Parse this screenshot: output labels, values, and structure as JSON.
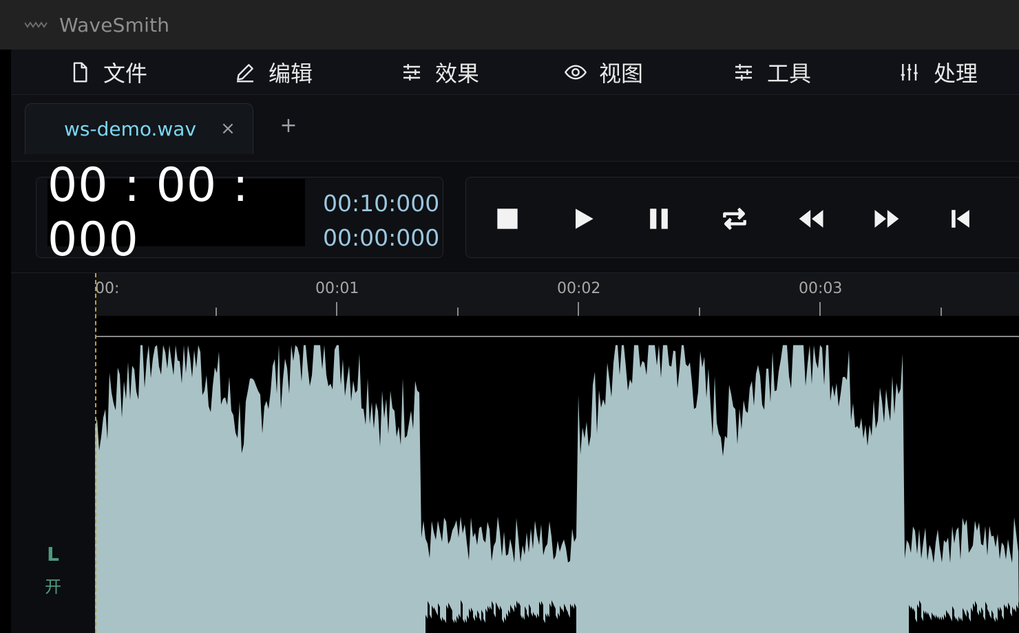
{
  "app": {
    "title": "WaveSmith",
    "logo_icon": "wave-logo-icon"
  },
  "menu": [
    {
      "label": "文件",
      "icon": "file-icon"
    },
    {
      "label": "编辑",
      "icon": "pencil-icon"
    },
    {
      "label": "效果",
      "icon": "sliders-icon"
    },
    {
      "label": "视图",
      "icon": "eye-icon"
    },
    {
      "label": "工具",
      "icon": "sliders-icon"
    },
    {
      "label": "处理",
      "icon": "levels-icon"
    }
  ],
  "tabs": [
    {
      "label": "ws-demo.wav",
      "close": "×",
      "active": true
    }
  ],
  "add_tab": "+",
  "time": {
    "current": "00 : 00 : 000",
    "total": "00:10:000",
    "selection": "00:00:000"
  },
  "transport": [
    "stop-icon",
    "play-icon",
    "pause-icon",
    "loop-icon",
    "rewind-icon",
    "fast-forward-icon",
    "skip-to-start-icon"
  ],
  "timeline": {
    "labels": [
      "00:",
      "00:01",
      "00:02",
      "00:03"
    ]
  },
  "track": {
    "channel": "L",
    "state": "开"
  },
  "colors": {
    "accent": "#7ad7f0",
    "waveform": "#a9c2c6",
    "channel": "#4f9a80",
    "playhead": "#c9a227"
  }
}
